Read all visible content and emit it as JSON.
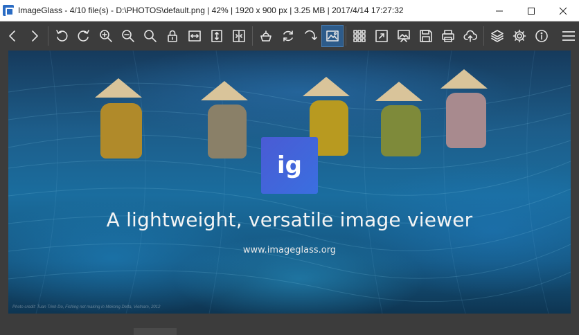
{
  "titlebar": {
    "app_icon": "imageglass-app-icon",
    "title": "ImageGlass - 4/10 file(s) - D:\\PHOTOS\\default.png | 42% | 1920 x 900 px | 3.25 MB | 2017/4/14 17:27:32",
    "controls": [
      "minimize-icon",
      "maximize-icon",
      "close-icon"
    ]
  },
  "toolbar": {
    "buttons": [
      "previous-icon",
      "next-icon",
      "rotate-left-icon",
      "rotate-right-icon",
      "zoom-in-icon",
      "zoom-out-icon",
      "actual-size-icon",
      "lock-zoom-icon",
      "fit-width-icon",
      "fit-height-icon",
      "scale-to-fit-icon",
      "checkerboard-icon",
      "refresh-icon",
      "goto-icon",
      "thumbnail-bar-icon",
      "grid-icon",
      "fullscreen-icon",
      "slideshow-icon",
      "save-icon",
      "print-icon",
      "upload-icon",
      "layers-icon",
      "settings-icon",
      "info-icon"
    ],
    "active_button": "thumbnail-bar-icon",
    "menu_icon": "hamburger-menu-icon"
  },
  "viewer": {
    "logo_text": "ig",
    "tagline": "A lightweight, versatile image viewer",
    "url": "www.imageglass.org",
    "photo_credit": "Photo credit: Tuan Trinh Do, Fishing net making in Mekong Delta, Vietnam, 2012"
  },
  "colors": {
    "titlebar_bg": "#ffffff",
    "toolbar_bg": "#3c3c3c",
    "active_button_bg": "#2d5b8a",
    "logo_tile": "#4a5bd4"
  }
}
